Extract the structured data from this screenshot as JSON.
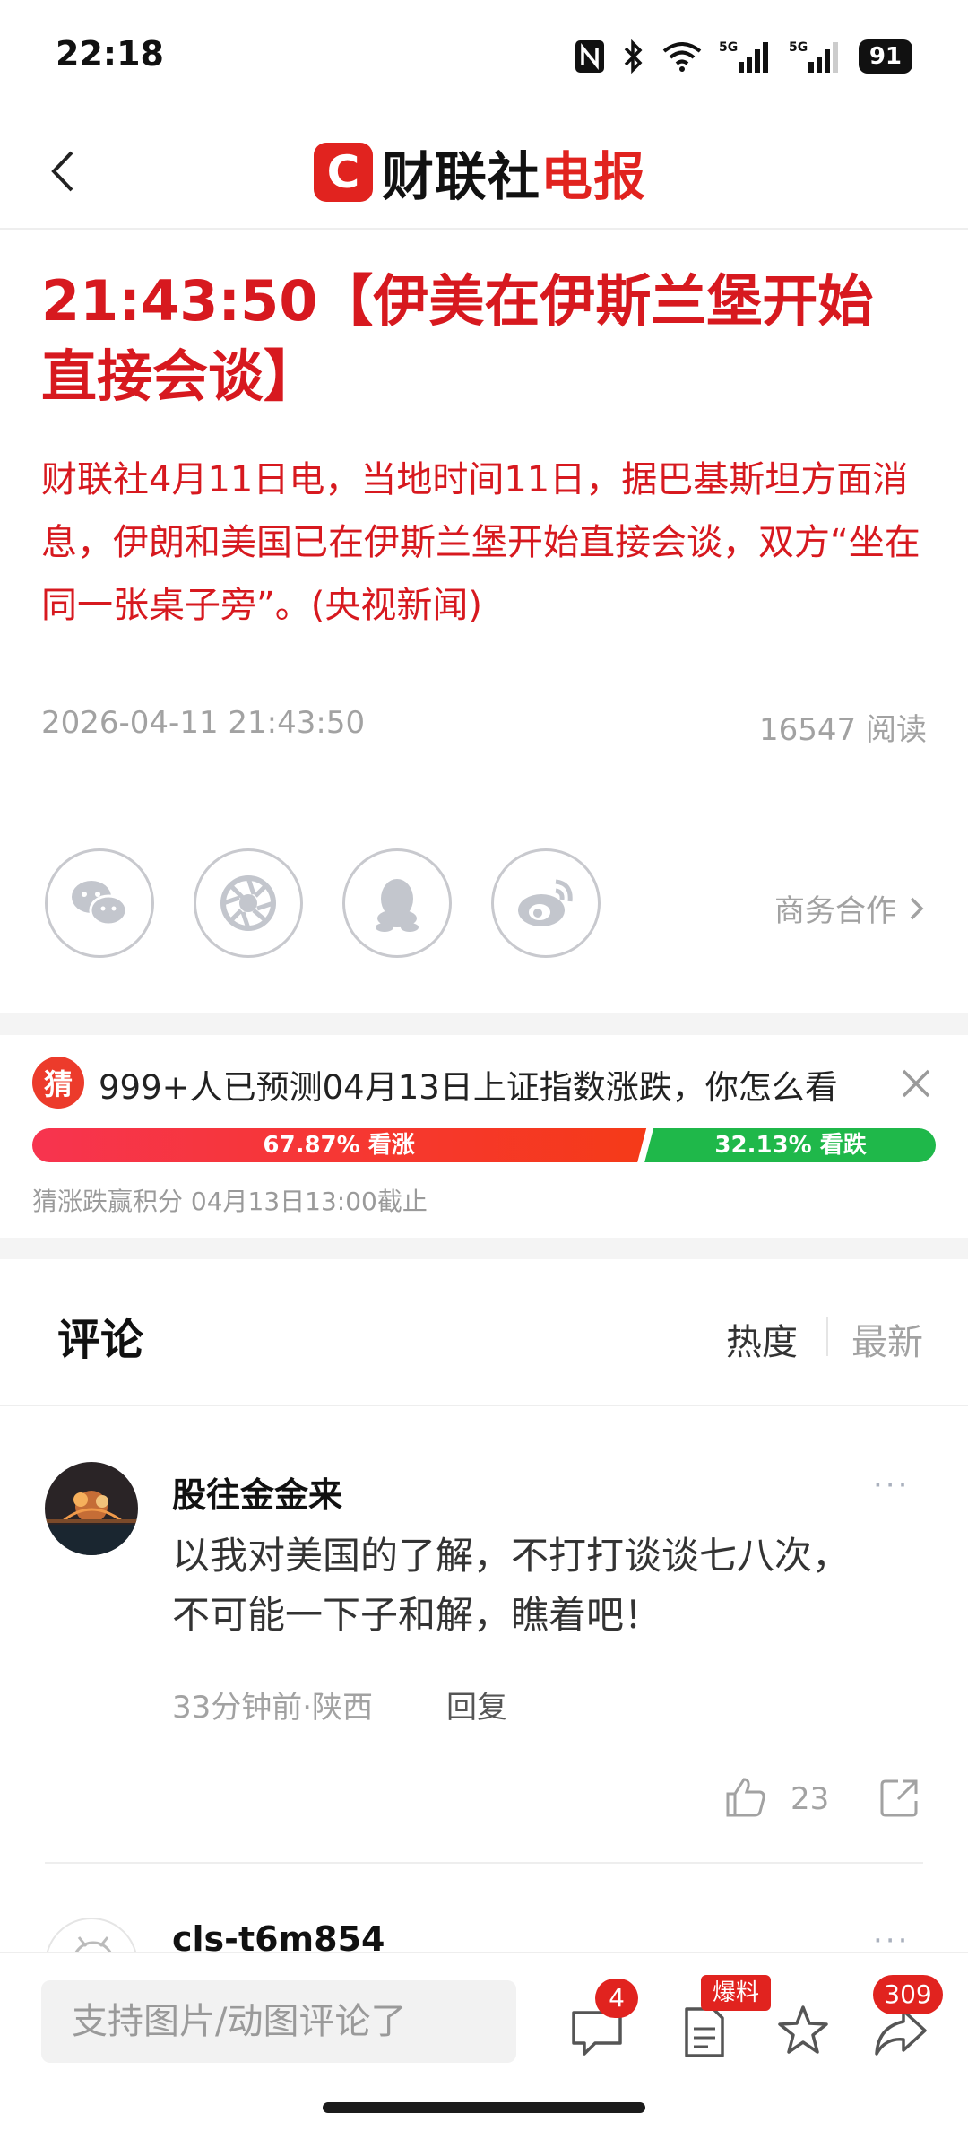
{
  "status_bar": {
    "time": "22:18",
    "battery": "91",
    "network1": "5G",
    "network2": "5G"
  },
  "nav": {
    "logo_text_black": "财联社",
    "logo_text_red": "电报",
    "logo_letter": "C"
  },
  "article": {
    "headline": "21:43:50【伊美在伊斯兰堡开始直接会谈】",
    "body": "财联社4月11日电，当地时间11日，据巴基斯坦方面消息，伊朗和美国已在伊斯兰堡开始直接会谈，双方“坐在同一张桌子旁”。(央视新闻)",
    "datetime": "2026-04-11 21:43:50",
    "reads": "16547 阅读"
  },
  "share": {
    "items": [
      "wechat-icon",
      "moments-icon",
      "qq-icon",
      "weibo-icon"
    ],
    "business": "商务合作"
  },
  "prediction": {
    "badge": "猜",
    "title": "999+人已预测04月13日上证指数涨跌，你怎么看",
    "up_label": "67.87% 看涨",
    "down_label": "32.13% 看跌",
    "up_share": 0.6787,
    "down_share": 0.3213,
    "note": "猜涨跌赢积分  04月13日13:00截止"
  },
  "comments": {
    "title": "评论",
    "sort_hot": "热度",
    "sort_new": "最新",
    "items": [
      {
        "user": "股往金金来",
        "text_line1": "以我对美国的了解，不打打谈谈七八次，",
        "text_line2": "不可能一下子和解，瞧着吧！",
        "meta": "33分钟前·陕西",
        "reply": "回复",
        "likes": "23",
        "more": "···"
      },
      {
        "user": "cls-t6m854",
        "more": "···"
      }
    ]
  },
  "bottom_bar": {
    "input_placeholder": "支持图片/动图评论了",
    "comment_count": "4",
    "tip_label": "爆料",
    "share_count": "309"
  },
  "colors": {
    "accent": "#e1231f",
    "headline": "#d7191f",
    "up": "#f03a2c",
    "down": "#1fb84a"
  }
}
